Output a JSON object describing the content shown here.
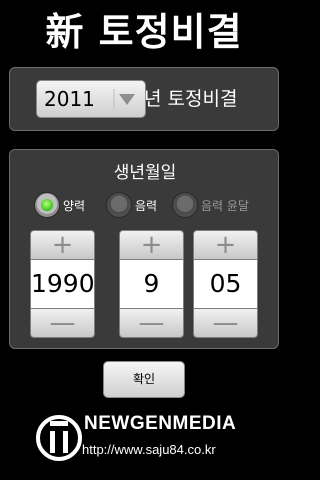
{
  "app": {
    "title": "新 토정비결"
  },
  "year_panel": {
    "year_value": "2011",
    "suffix": "년 토정비결"
  },
  "birth_panel": {
    "label": "생년월일",
    "calendar_options": [
      {
        "label": "양력",
        "selected": true
      },
      {
        "label": "음력",
        "selected": false
      },
      {
        "label": "음력 윤달",
        "selected": false
      }
    ],
    "year": "1990",
    "month": "9",
    "day": "05",
    "plus": "+",
    "minus": "—"
  },
  "confirm_label": "확인",
  "footer": {
    "brand": "NEWGENMEDIA",
    "url": "http://www.saju84.co.kr"
  },
  "colors": {
    "radio_selected": "#35c21a",
    "panel_bg": "#3a3a3a"
  }
}
